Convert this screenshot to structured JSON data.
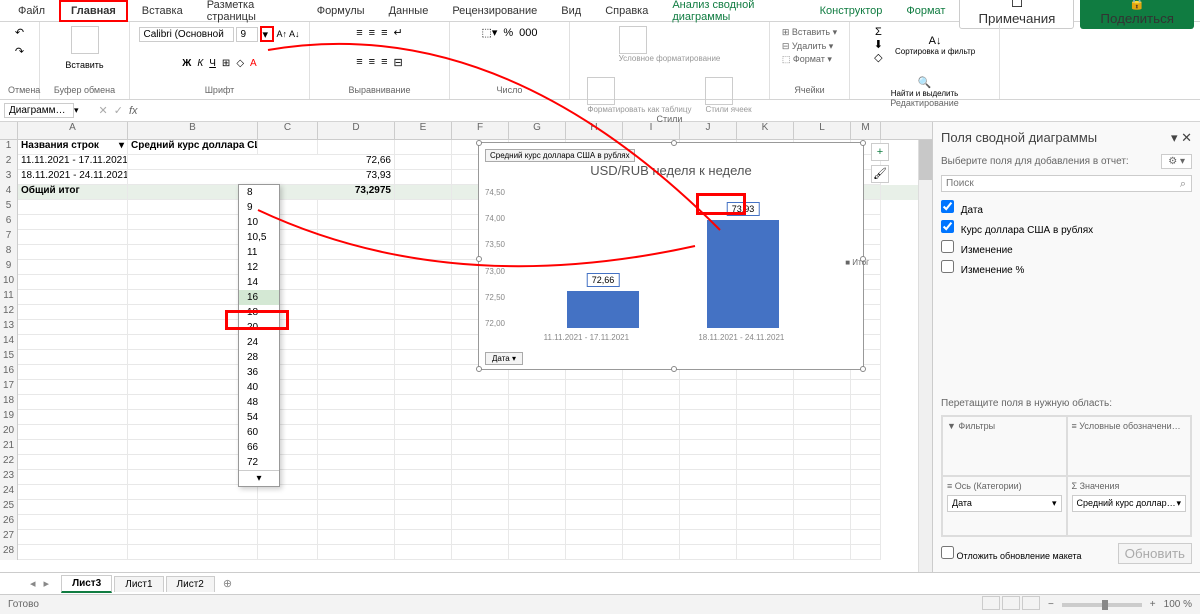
{
  "tabs": [
    "Файл",
    "Главная",
    "Вставка",
    "Разметка страницы",
    "Формулы",
    "Данные",
    "Рецензирование",
    "Вид",
    "Справка",
    "Анализ сводной диаграммы",
    "Конструктор",
    "Формат"
  ],
  "active_tab": "Главная",
  "comments_btn": "Примечания",
  "share_btn": "Поделиться",
  "ribbon_groups": {
    "undo": "Отмена",
    "clipboard": "Буфер обмена",
    "clipboard_paste": "Вставить",
    "font": "Шрифт",
    "font_name": "Calibri (Основной",
    "font_size": "9",
    "alignment": "Выравнивание",
    "number": "Число",
    "styles": "Стили",
    "styles_cond": "Условное форматирование",
    "styles_table": "Форматировать как таблицу",
    "styles_cell": "Стили ячеек",
    "cells": "Ячейки",
    "cells_insert": "Вставить",
    "cells_delete": "Удалить",
    "cells_format": "Формат",
    "editing": "Редактирование",
    "editing_sort": "Сортировка и фильтр",
    "editing_find": "Найти и выделить"
  },
  "font_sizes": [
    "8",
    "9",
    "10",
    "10,5",
    "11",
    "12",
    "14",
    "16",
    "18",
    "20",
    "24",
    "28",
    "36",
    "40",
    "48",
    "54",
    "60",
    "66",
    "72"
  ],
  "font_size_highlight": "16",
  "name_box": "Диаграмм…",
  "columns": {
    "A": 110,
    "B": 130,
    "C": 60,
    "D": 77,
    "E": 57,
    "F": 57,
    "G": 57,
    "H": 57,
    "I": 57,
    "J": 57,
    "K": 57,
    "L": 57,
    "M": 30
  },
  "pivot": {
    "header_row_labels": "Названия строк",
    "header_value": "Средний курс доллара США в рублях",
    "rows": [
      {
        "label": "11.11.2021 - 17.11.2021",
        "value": "72,66"
      },
      {
        "label": "18.11.2021 - 24.11.2021",
        "value": "73,93"
      }
    ],
    "total_label": "Общий итог",
    "total_value": "73,2975"
  },
  "chart_data": {
    "type": "bar",
    "title": "USD/RUB неделя к неделе",
    "button_top": "Средний курс доллара США в рублях",
    "button_bottom": "Дата",
    "categories": [
      "11.11.2021 - 17.11.2021",
      "18.11.2021 - 24.11.2021"
    ],
    "values": [
      72.66,
      73.93
    ],
    "value_labels": [
      "72,66",
      "73,93"
    ],
    "ylim": [
      72.0,
      74.5
    ],
    "yticks": [
      "74,50",
      "74,00",
      "73,50",
      "73,00",
      "72,50",
      "72,00"
    ],
    "legend": "Итог"
  },
  "fields_pane": {
    "title": "Поля сводной диаграммы",
    "subtitle": "Выберите поля для добавления в отчет:",
    "search_placeholder": "Поиск",
    "fields": [
      {
        "label": "Дата",
        "checked": true
      },
      {
        "label": "Курс доллара США в рублях",
        "checked": true
      },
      {
        "label": "Изменение",
        "checked": false
      },
      {
        "label": "Изменение %",
        "checked": false
      }
    ],
    "drag_label": "Перетащите поля в нужную область:",
    "filters": "Фильтры",
    "legend_area": "Условные обозначени…",
    "axis": "Ось (Категории)",
    "axis_field": "Дата",
    "values": "Значения",
    "values_field": "Средний курс доллар…",
    "defer": "Отложить обновление макета",
    "update": "Обновить"
  },
  "sheet_tabs": [
    "Лист3",
    "Лист1",
    "Лист2"
  ],
  "active_sheet": "Лист3",
  "status": "Готово",
  "zoom": "100 %"
}
